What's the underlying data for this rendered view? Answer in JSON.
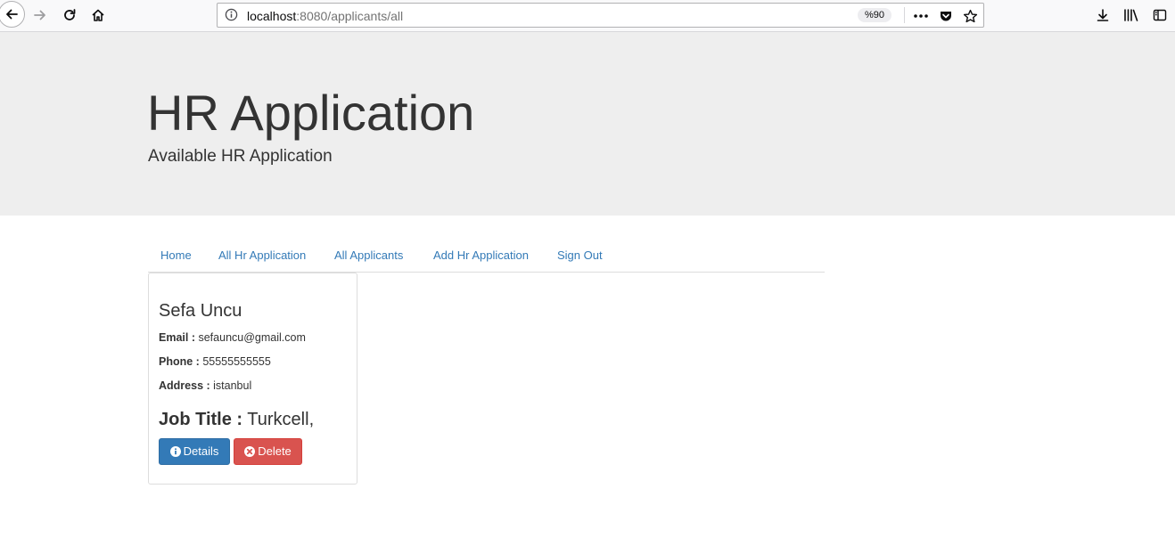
{
  "browser": {
    "url_host": "localhost",
    "url_path": ":8080/applicants/all",
    "zoom": "%90"
  },
  "jumbotron": {
    "title": "HR Application",
    "subtitle": "Available HR Application"
  },
  "nav": {
    "items": [
      {
        "label": "Home"
      },
      {
        "label": "All Hr Application"
      },
      {
        "label": "All Applicants"
      },
      {
        "label": "Add Hr Application"
      },
      {
        "label": "Sign Out"
      }
    ]
  },
  "applicant": {
    "name": "Sefa Uncu",
    "email_label": "Email :",
    "email": "sefauncu@gmail.com",
    "phone_label": "Phone :",
    "phone": "55555555555",
    "address_label": "Address :",
    "address": "istanbul",
    "job_label": "Job Title :",
    "job_title": "Turkcell,",
    "details_label": "Details",
    "delete_label": "Delete"
  },
  "colors": {
    "link": "#337ab7",
    "primary": "#337ab7",
    "danger": "#d9534f",
    "jumbotron_bg": "#eeeeee"
  },
  "icons": {
    "back": "arrow-left-icon",
    "forward": "arrow-right-icon",
    "reload": "reload-icon",
    "home": "home-icon",
    "info": "info-circle-icon",
    "more": "ellipsis-icon",
    "pocket": "pocket-icon",
    "bookmark": "star-icon",
    "download": "download-icon",
    "library": "library-icon",
    "sidebar": "sidebar-icon",
    "details": "info-sign-icon",
    "delete": "remove-sign-icon"
  }
}
